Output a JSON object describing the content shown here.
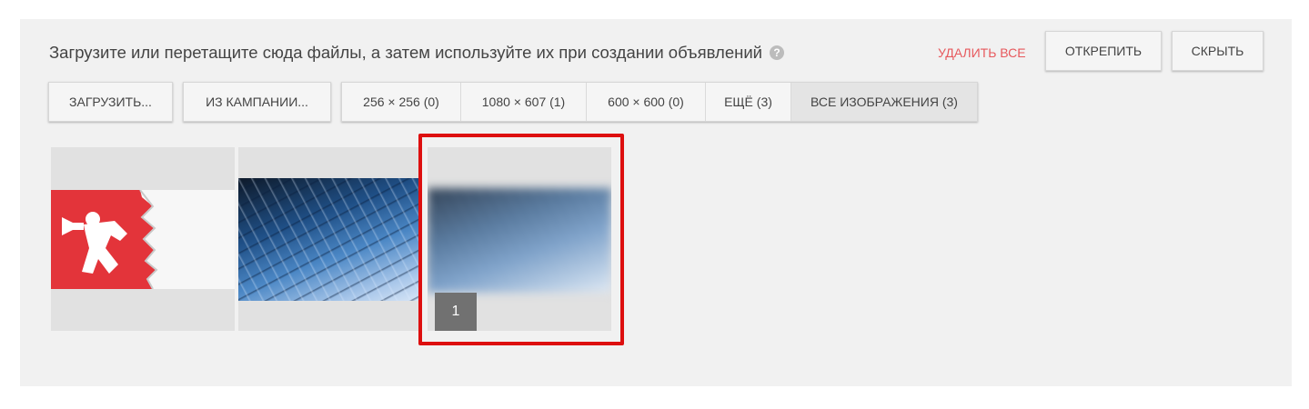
{
  "header": {
    "instruction": "Загрузите или перетащите сюда файлы, а затем используйте их при создании объявлений",
    "help_icon": "?",
    "delete_all": "УДАЛИТЬ ВСЕ",
    "unpin": "ОТКРЕПИТЬ",
    "hide": "СКРЫТЬ"
  },
  "toolbar": {
    "upload": "ЗАГРУЗИТЬ...",
    "from_campaign": "ИЗ КАМПАНИИ...",
    "filters": [
      {
        "label": "256 × 256 (0)",
        "active": false
      },
      {
        "label": "1080 × 607 (1)",
        "active": false
      },
      {
        "label": "600 × 600 (0)",
        "active": false
      },
      {
        "label": "ЕЩЁ (3)",
        "active": false
      },
      {
        "label": "ВСЕ ИЗОБРАЖЕНИЯ (3)",
        "active": true
      }
    ]
  },
  "gallery": {
    "images": [
      {
        "name": "megaphone-banner-image",
        "selected": false
      },
      {
        "name": "keyboard-photo-image",
        "selected": false
      },
      {
        "name": "keyboard-photo-blurred-image",
        "selected": true,
        "badge": "1"
      }
    ]
  },
  "colors": {
    "panel_bg": "#f1f1f1",
    "accent_red": "#e7595d",
    "highlight_red": "#dd0f0f",
    "banner_red": "#e3343a"
  }
}
